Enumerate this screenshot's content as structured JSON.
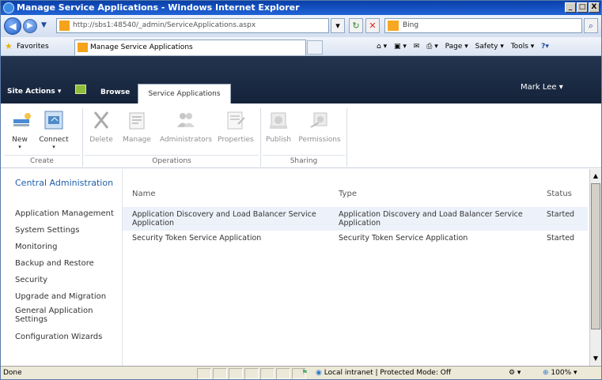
{
  "window": {
    "title": "Manage Service Applications - Windows Internet Explorer",
    "min": "_",
    "max": "□",
    "close": "X"
  },
  "addressbar": {
    "url": "http://sbs1:48540/_admin/ServiceApplications.aspx",
    "search_text": "Bing"
  },
  "favorites": {
    "label": "Favorites",
    "tab_title": "Manage Service Applications",
    "commands": [
      "Page ▾",
      "Safety ▾",
      "Tools ▾"
    ]
  },
  "sharepoint": {
    "site_actions": "Site Actions ▾",
    "browse": "Browse",
    "active_tab": "Service Applications",
    "user": "Mark Lee ▾"
  },
  "ribbon": {
    "groups": [
      {
        "label": "Create",
        "buttons": [
          "New",
          "Connect"
        ]
      },
      {
        "label": "Operations",
        "buttons": [
          "Delete",
          "Manage",
          "Administrators",
          "Properties"
        ]
      },
      {
        "label": "Sharing",
        "buttons": [
          "Publish",
          "Permissions"
        ]
      }
    ]
  },
  "nav": {
    "title": "Central Administration",
    "items": [
      "Application Management",
      "System Settings",
      "Monitoring",
      "Backup and Restore",
      "Security",
      "Upgrade and Migration",
      "General Application Settings",
      "Configuration Wizards"
    ]
  },
  "table": {
    "headers": [
      "Name",
      "Type",
      "Status"
    ],
    "rows": [
      {
        "name": "Application Discovery and Load Balancer Service Application",
        "type": "Application Discovery and Load Balancer Service Application",
        "status": "Started"
      },
      {
        "name": "Security Token Service Application",
        "type": "Security Token Service Application",
        "status": "Started"
      }
    ]
  },
  "statusbar": {
    "text": "Done",
    "zone": "Local intranet | Protected Mode: Off",
    "zoom": "100%"
  }
}
